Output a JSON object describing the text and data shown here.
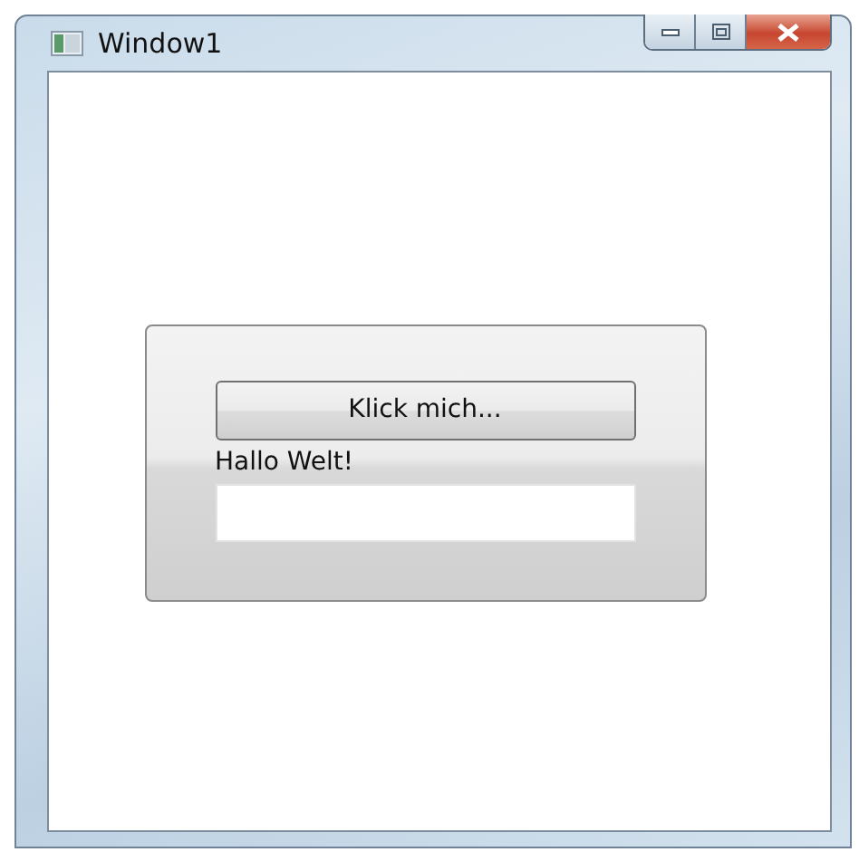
{
  "window": {
    "title": "Window1"
  },
  "panel": {
    "button": "Klick mich...",
    "label": "Hallo Welt!"
  }
}
